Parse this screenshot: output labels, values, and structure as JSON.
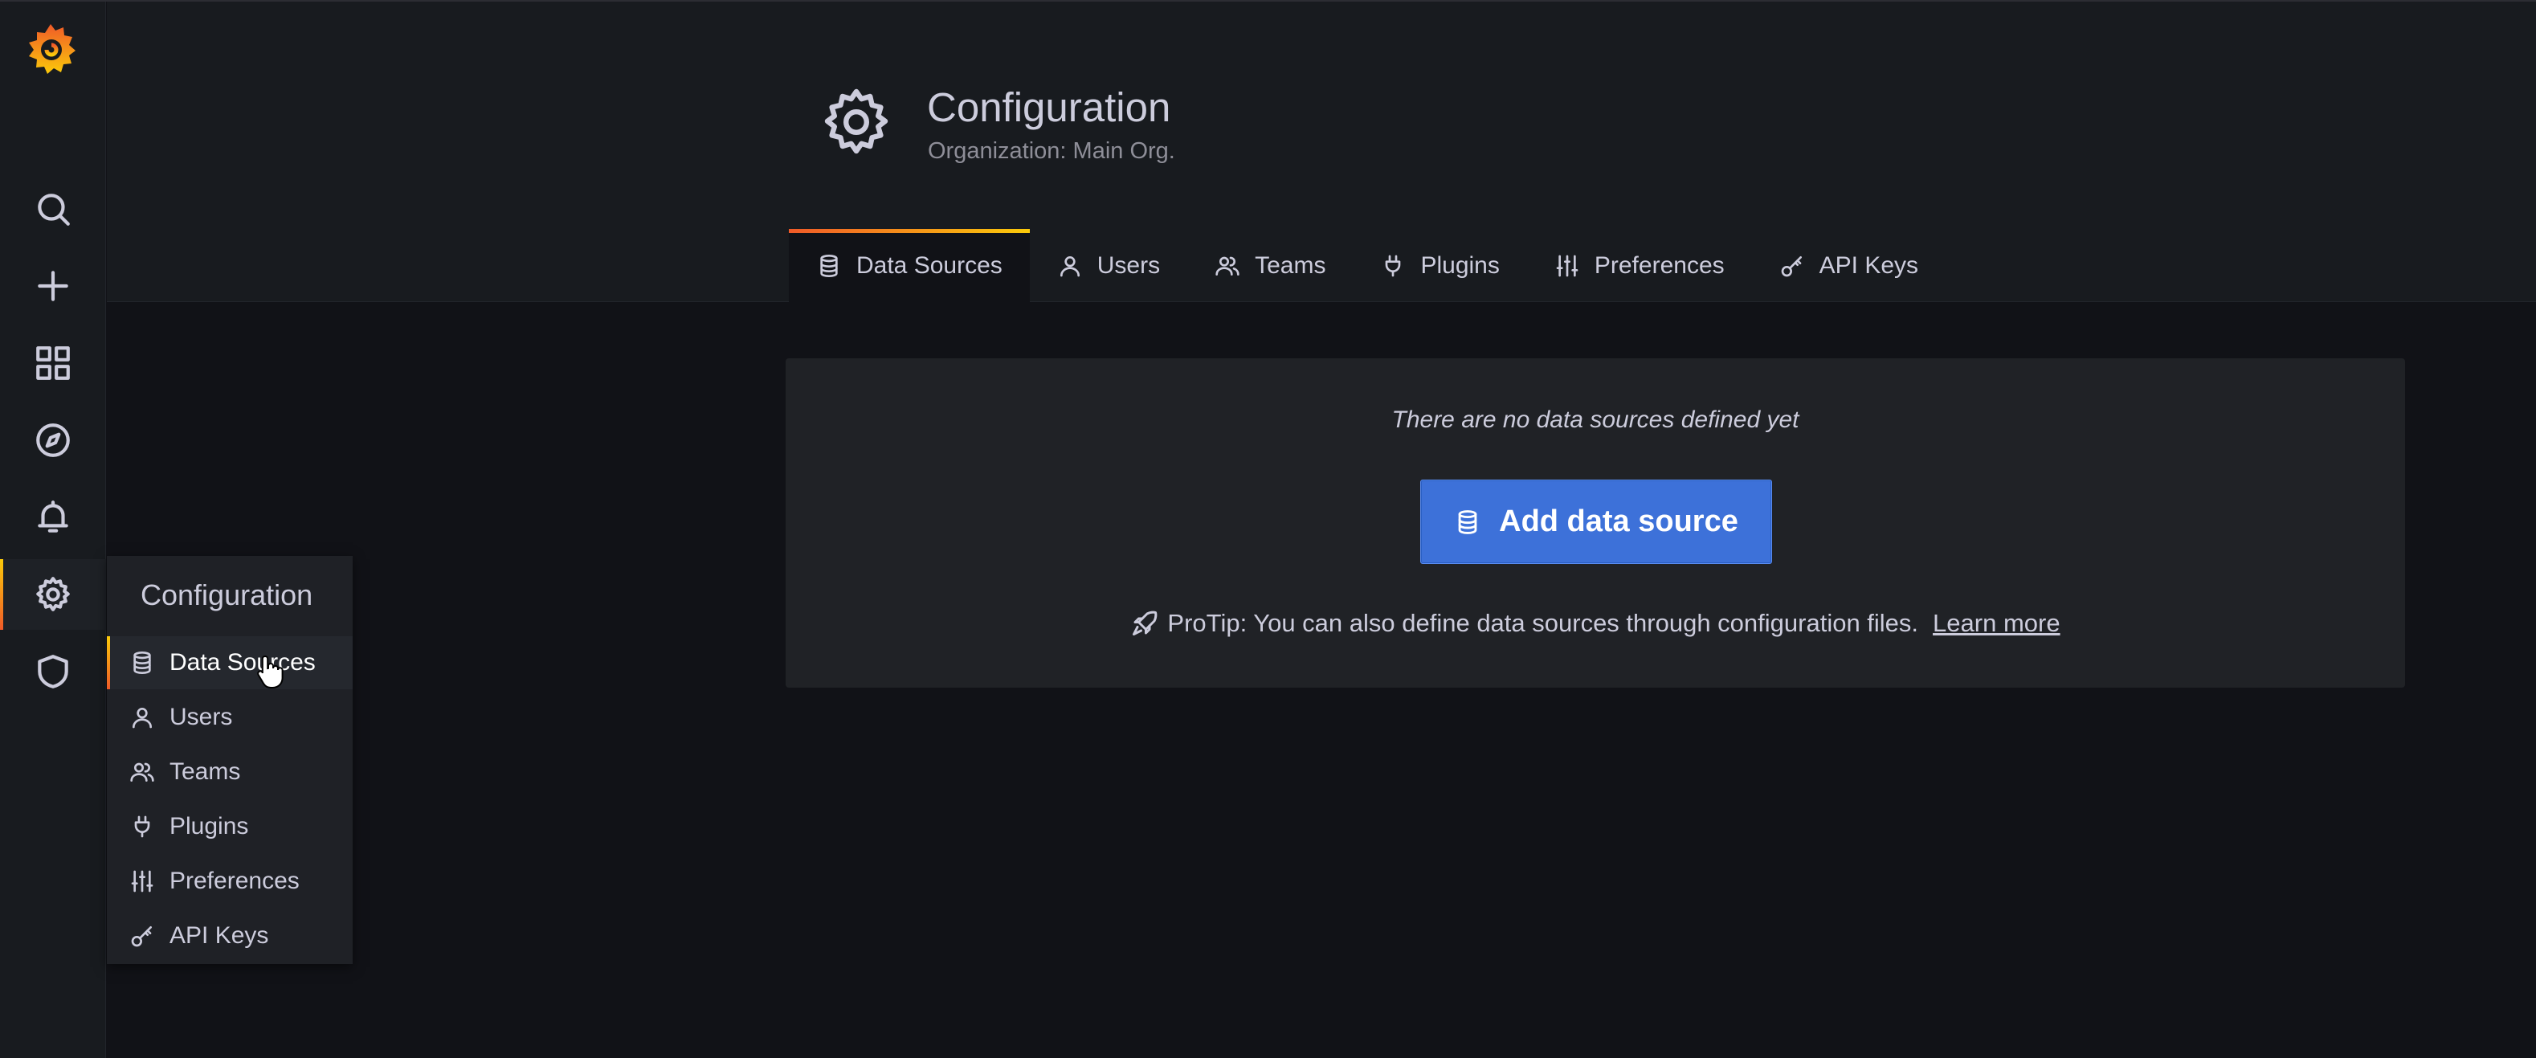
{
  "header": {
    "title": "Configuration",
    "subtitle": "Organization: Main Org."
  },
  "tabs": [
    {
      "label": "Data Sources",
      "icon": "database-icon",
      "active": true
    },
    {
      "label": "Users",
      "icon": "user-icon",
      "active": false
    },
    {
      "label": "Teams",
      "icon": "users-icon",
      "active": false
    },
    {
      "label": "Plugins",
      "icon": "plug-icon",
      "active": false
    },
    {
      "label": "Preferences",
      "icon": "sliders-icon",
      "active": false
    },
    {
      "label": "API Keys",
      "icon": "key-icon",
      "active": false
    }
  ],
  "main": {
    "empty_message": "There are no data sources defined yet",
    "add_button": "Add data source",
    "protip": "ProTip: You can also define data sources through configuration files.",
    "learn_more": "Learn more"
  },
  "sidebar": {
    "icons": [
      "grafana-logo",
      "search-icon",
      "plus-icon",
      "dashboards-icon",
      "explore-icon",
      "alert-bell-icon",
      "gear-icon",
      "shield-icon"
    ],
    "active": "gear-icon"
  },
  "flyout": {
    "title": "Configuration",
    "items": [
      {
        "label": "Data Sources",
        "icon": "database-icon",
        "active": true
      },
      {
        "label": "Users",
        "icon": "user-icon",
        "active": false
      },
      {
        "label": "Teams",
        "icon": "users-icon",
        "active": false
      },
      {
        "label": "Plugins",
        "icon": "plug-icon",
        "active": false
      },
      {
        "label": "Preferences",
        "icon": "sliders-icon",
        "active": false
      },
      {
        "label": "API Keys",
        "icon": "key-icon",
        "active": false
      }
    ]
  },
  "colors": {
    "accent_gradient_start": "#f05a28",
    "accent_gradient_end": "#fbca0a",
    "primary_button": "#3d71d9",
    "background": "#111217",
    "panel": "#181b1f"
  }
}
